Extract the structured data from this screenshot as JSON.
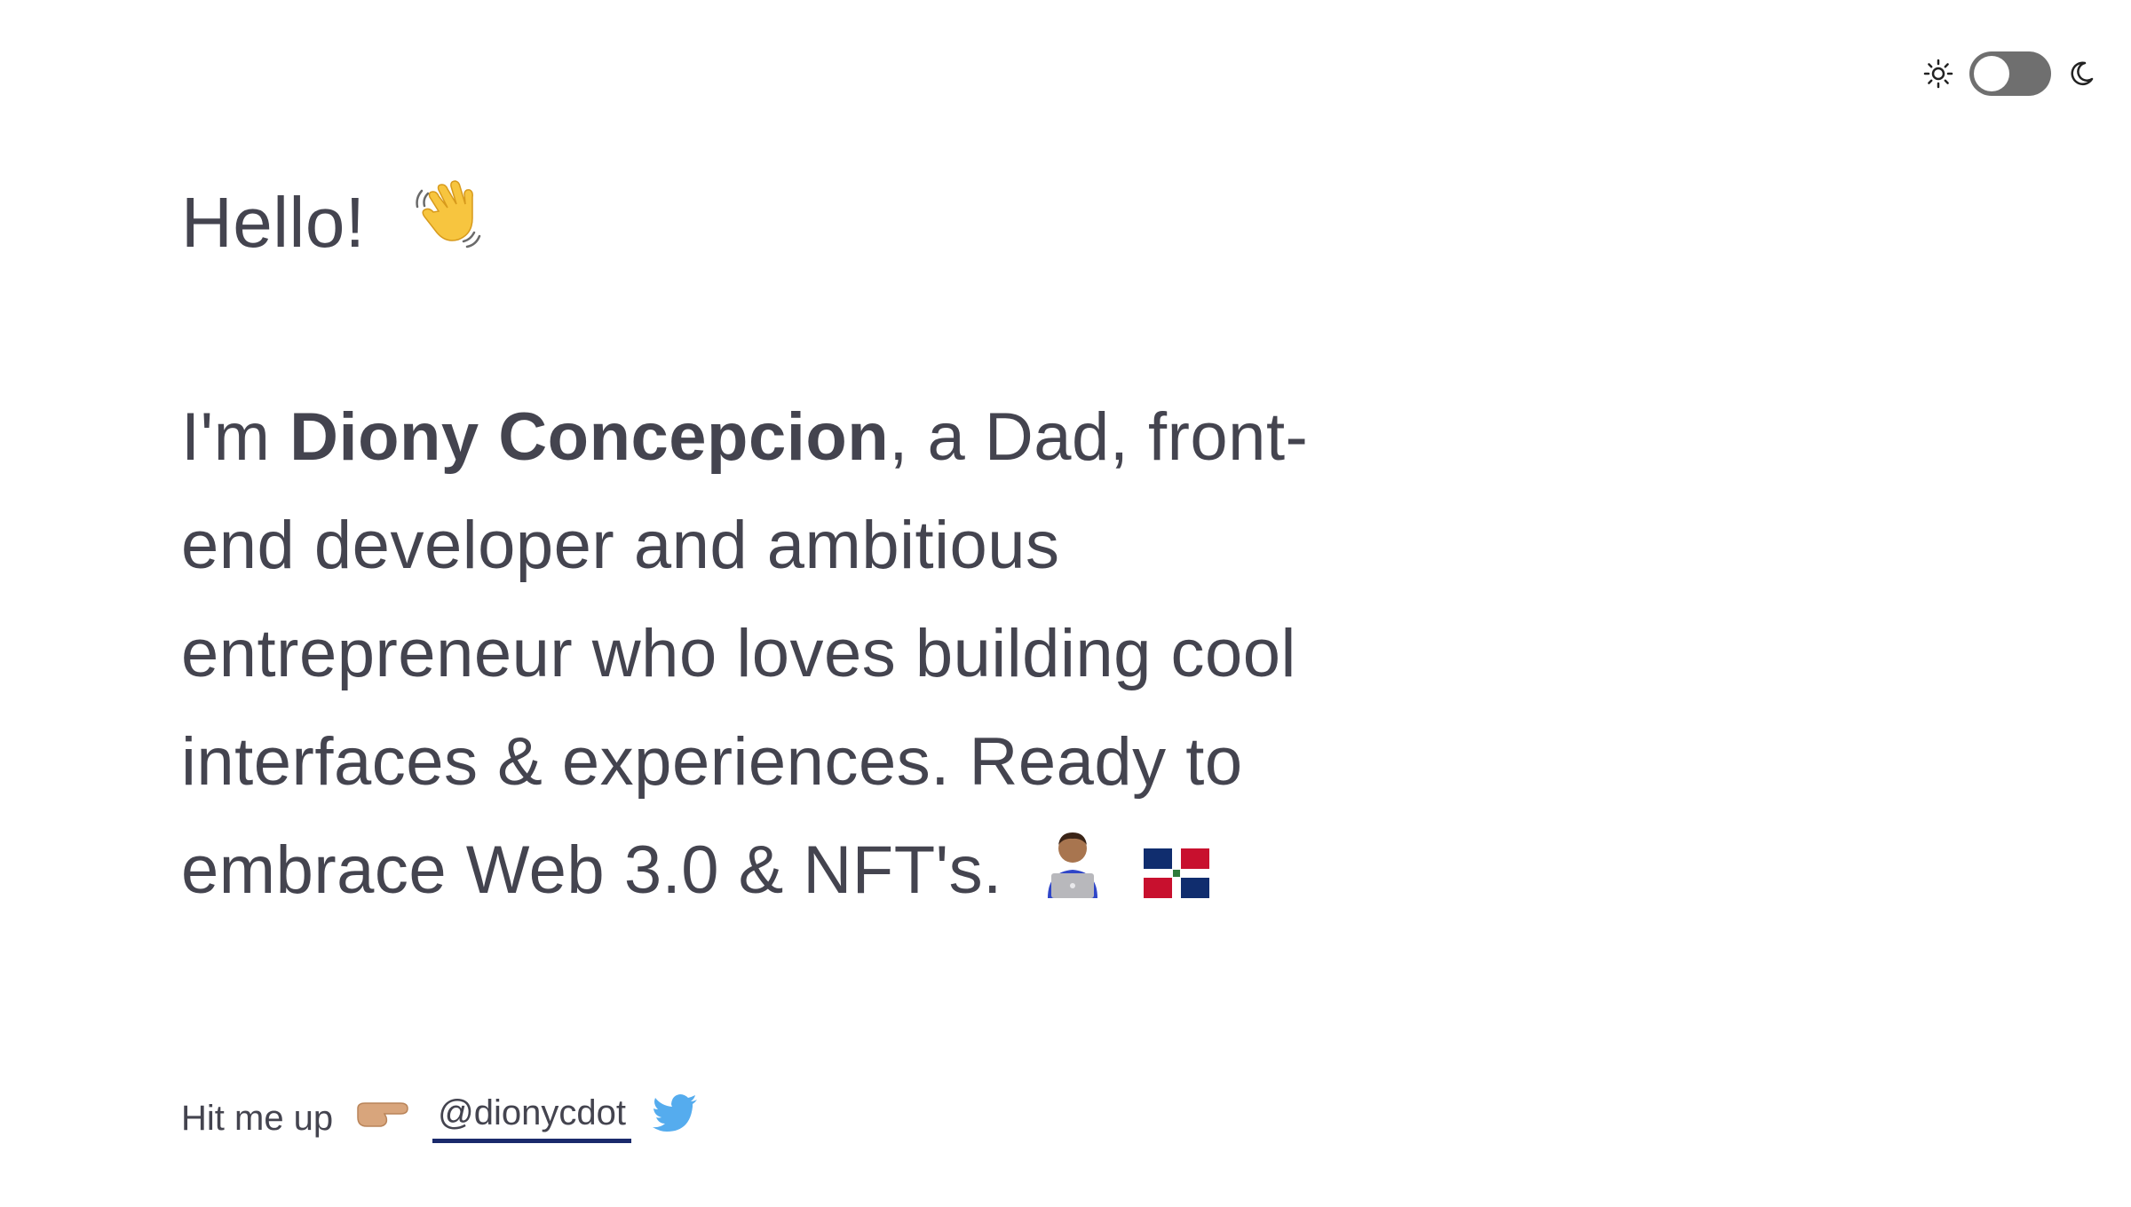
{
  "theme_toggle": {
    "light_icon": "sun-icon",
    "dark_icon": "moon-icon",
    "state": "light"
  },
  "greeting": {
    "text": "Hello!",
    "emoji": "waving-hand-emoji"
  },
  "bio": {
    "intro": "I'm ",
    "name": "Diony Concepcion",
    "line1_rest": ", a Dad, front-",
    "line2": "end developer and ambitious",
    "line3": "entrepreneur who loves building cool",
    "line4": "interfaces & experiences. Ready to",
    "line5": "embrace Web 3.0 & NFT's.",
    "emoji_technologist": "man-technologist-emoji",
    "emoji_flag": "dominican-republic-flag-emoji"
  },
  "contact": {
    "label": "Hit me up",
    "point_emoji": "backhand-index-pointing-right-emoji",
    "handle": "@dionycdot",
    "twitter_icon": "twitter-bird-icon"
  },
  "colors": {
    "text": "#44444f",
    "link_underline": "#1a2a6c",
    "toggle_track": "#6f6f6f",
    "twitter_blue": "#55acee"
  }
}
